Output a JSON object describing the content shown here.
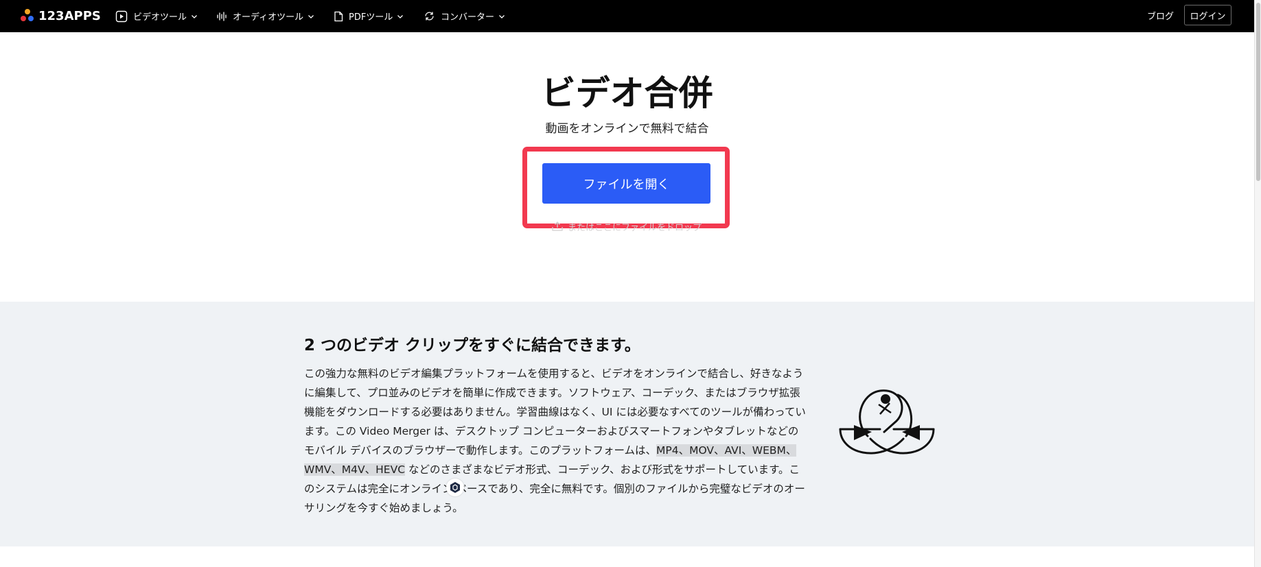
{
  "nav": {
    "logo": "123APPS",
    "logo_colors": [
      "#f5a623",
      "#e5363a",
      "#2f6df6"
    ],
    "items": [
      {
        "label": "ビデオツール",
        "icon": "play-circle-icon"
      },
      {
        "label": "オーディオツール",
        "icon": "waveform-icon"
      },
      {
        "label": "PDFツール",
        "icon": "document-icon"
      },
      {
        "label": "コンバーター",
        "icon": "convert-icon"
      }
    ],
    "blog": "ブログ",
    "login": "ログイン"
  },
  "hero": {
    "title": "ビデオ合併",
    "subtitle": "動画をオンラインで無料で結合",
    "open_button": "ファイルを開く",
    "drop_hint": "またはここにファイルをドロップ",
    "highlight_color": "#f2394f",
    "button_color": "#2b5cf6"
  },
  "info": {
    "title": "2 つのビデオ クリップをすぐに結合できます。",
    "body_1": "この強力な無料のビデオ編集プラットフォームを使用すると、ビデオをオンラインで結合し、好きなように編集して、プロ並みのビデオを簡単に作成できます。ソフトウェア、コーデック、またはブラウザ拡張機能をダウンロードする必要はありません。学習曲線はなく、UI には必要なすべてのツールが備わっています。この Video Merger は、デスクトップ コンピューターおよびスマートフォンやタブレットなどのモバイル デバイスのブラウザーで動作します。このプラットフォームは、",
    "formats": "MP4、MOV、AVI、WEBM、WMV、M4V、HEVC",
    "body_2": " などのさまざまなビデオ形式、コーデック、および形式をサポートしています。このシステムは完全にオンライン ベースであり、完全に無料です。個別のファイルから完璧なビデオのオーサリングを今すぐ始めましょう。",
    "background": "#eff2f5"
  }
}
